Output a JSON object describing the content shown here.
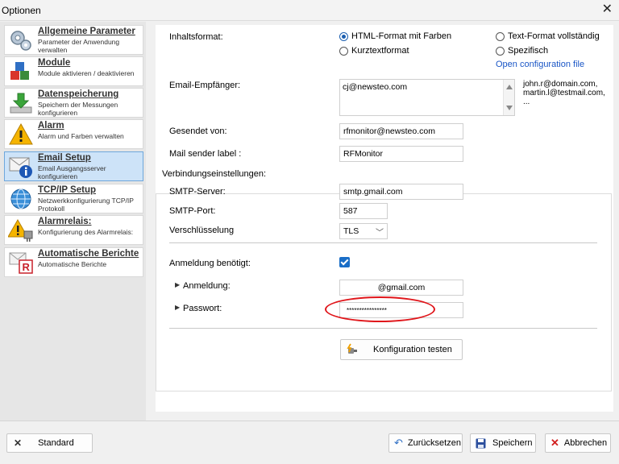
{
  "window": {
    "title": "Optionen"
  },
  "sidebar": {
    "items": [
      {
        "title": "Allgemeine Parameter",
        "desc": "Parameter der Anwendung verwalten",
        "icon": "gears-icon"
      },
      {
        "title": "Module",
        "desc": "Module aktivieren / deaktivieren",
        "icon": "cubes-icon"
      },
      {
        "title": "Datenspeicherung",
        "desc": "Speichern der Messungen konfigurieren",
        "icon": "download-icon"
      },
      {
        "title": "Alarm",
        "desc": "Alarm und Farben verwalten",
        "icon": "warning-icon"
      },
      {
        "title": "Email Setup",
        "desc": "Email Ausgangsserver konfigurieren",
        "icon": "email-info-icon",
        "active": true
      },
      {
        "title": "TCP/IP Setup",
        "desc": "Netzwerkkonfigurierung TCP/IP Protokoll",
        "icon": "network-globe-icon"
      },
      {
        "title": "Alarmrelais:",
        "desc": "Konfigurierung des Alarmrelais:",
        "icon": "relay-warning-icon"
      },
      {
        "title": "Automatische Berichte",
        "desc": "Automatische Berichte",
        "icon": "report-icon"
      }
    ]
  },
  "content": {
    "format_label": "Inhaltsformat:",
    "format_options": [
      {
        "label": "HTML-Format mit Farben",
        "selected": true
      },
      {
        "label": "Kurztextformat",
        "selected": false
      },
      {
        "label": "Text-Format vollständig",
        "selected": false
      },
      {
        "label": "Spezifisch",
        "selected": false
      }
    ],
    "open_config_link": "Open configuration file",
    "recipient_label": "Email-Empfänger:",
    "recipient_value": "cj@newsteo.com",
    "recipient_hint": [
      "john.r@domain.com,",
      "martin.l@testmail.com,",
      "..."
    ],
    "sender_label": "Gesendet von:",
    "sender_value": "rfmonitor@newsteo.com",
    "sender_name_label": "Mail sender label :",
    "sender_name_value": "RFMonitor",
    "connection_group_title": "Verbindungseinstellungen:",
    "smtp_server_label": "SMTP-Server:",
    "smtp_server_value": "smtp.gmail.com",
    "smtp_port_label": "SMTP-Port:",
    "smtp_port_value": "587",
    "encryption_label": "Verschlüsselung",
    "encryption_value": "TLS",
    "auth_required_label": "Anmeldung benötigt:",
    "auth_required_checked": true,
    "login_label": "Anmeldung:",
    "login_value": "@gmail.com",
    "password_label": "Passwort:",
    "password_value": "****************",
    "test_button": "Konfiguration testen"
  },
  "footer": {
    "default_button": "Standard",
    "reset_button": "Zurücksetzen",
    "save_button": "Speichern",
    "cancel_button": "Abbrechen"
  },
  "colors": {
    "active_nav": "#cde3f8",
    "link": "#1a56c6",
    "checkbox": "#1a6ec7",
    "highlight_oval": "#e0161b"
  }
}
